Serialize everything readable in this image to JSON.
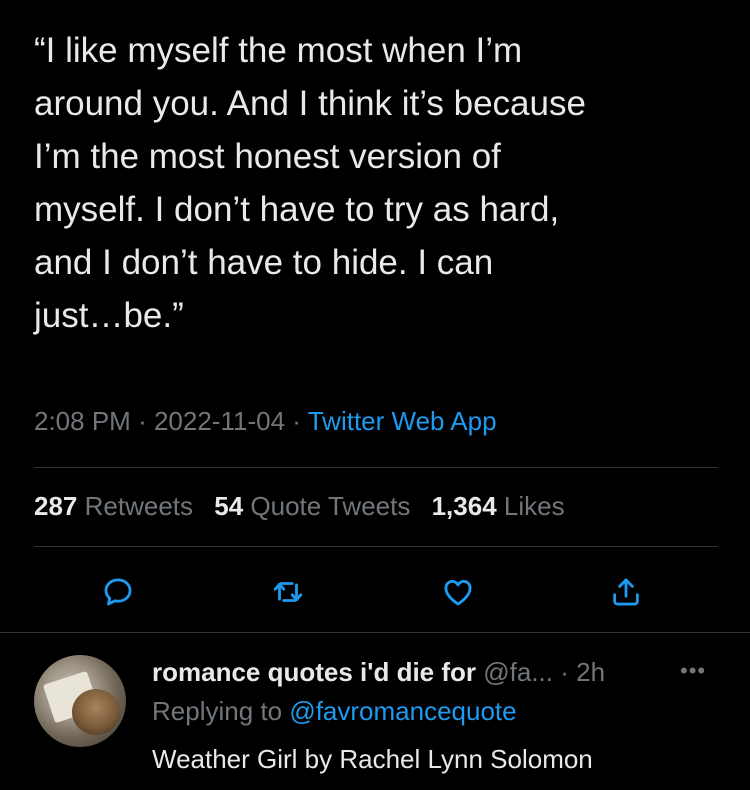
{
  "tweet": {
    "text": "“I like myself the most when I’m\naround you. And I think it’s because\nI’m the most honest version of\nmyself. I don’t have to try as hard,\nand I don’t have to hide. I can\njust…be.”",
    "time": "2:08 PM",
    "date": "2022-11-04",
    "source": "Twitter Web App",
    "separator": "·"
  },
  "stats": {
    "retweets_count": "287",
    "retweets_label": "Retweets",
    "quotes_count": "54",
    "quotes_label": "Quote Tweets",
    "likes_count": "1,364",
    "likes_label": "Likes"
  },
  "actions": {
    "icons": [
      "reply-icon",
      "retweet-icon",
      "like-icon",
      "share-icon"
    ],
    "icon_color": "#1d9bf0"
  },
  "reply": {
    "display_name": "romance quotes i'd die for",
    "handle": "@fa...",
    "separator": "·",
    "time": "2h",
    "more": "•••",
    "replying_label": "Replying to",
    "replying_handle": "@favromancequote",
    "text": "Weather Girl by Rachel Lynn Solomon"
  },
  "colors": {
    "background": "#000000",
    "text": "#e7e9ea",
    "secondary": "#71767b",
    "accent": "#1d9bf0",
    "divider": "#2f3336"
  }
}
